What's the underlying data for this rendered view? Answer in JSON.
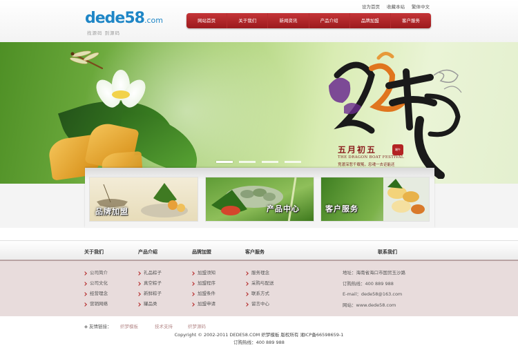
{
  "header": {
    "top_links": [
      "设为首页",
      "收藏本站",
      "繁体中文"
    ],
    "logo": {
      "main": "dede58",
      "suffix": ".com",
      "tagline": "找源码 到源码"
    },
    "nav": [
      "网站首页",
      "关于我们",
      "新闻资讯",
      "产品介绍",
      "品牌加盟",
      "客户服务"
    ]
  },
  "banner": {
    "festival_cn": "五月初五",
    "festival_en": "THE DRAGON BOAT FESTIVAL",
    "festival_line": "竞渡深悲千载冤，忠魂一去讵能还",
    "seal": "端午",
    "slides": 4,
    "active_slide": 1
  },
  "cards": [
    {
      "caption": "品牌加盟"
    },
    {
      "caption": "产品中心"
    },
    {
      "caption": "客户服务"
    }
  ],
  "footer": {
    "headings": [
      "关于我们",
      "产品介绍",
      "品牌加盟",
      "客户服务",
      "联系我们"
    ],
    "columns": [
      [
        "公司简介",
        "公司文化",
        "经营理念",
        "营销网络"
      ],
      [
        "礼品粽子",
        "真空粽子",
        "新鲜粽子",
        "罐品类"
      ],
      [
        "加盟须知",
        "加盟程序",
        "加盟条件",
        "加盟申请"
      ],
      [
        "服务理念",
        "采购与配送",
        "联系方式",
        "留言中心"
      ]
    ],
    "contact": [
      "地址：海南省海口市国贸玉沙路",
      "订购热线：400 889 988",
      "E-mail：dede58@163.com",
      "网站：www.dede58.com"
    ]
  },
  "friends": {
    "label": "友情链接：",
    "links": [
      "织梦模板",
      "技术支持",
      "织梦源码"
    ]
  },
  "copyright": {
    "line1": "Copyright © 2002-2011 DEDE58.COM 织梦模板 版权所有 湘ICP备66598659-1",
    "line2": "订购热线：400 889 988"
  },
  "colors": {
    "brand_red": "#b32323",
    "logo_blue": "#1f86c6",
    "footer_bg": "#e8dcdc"
  }
}
